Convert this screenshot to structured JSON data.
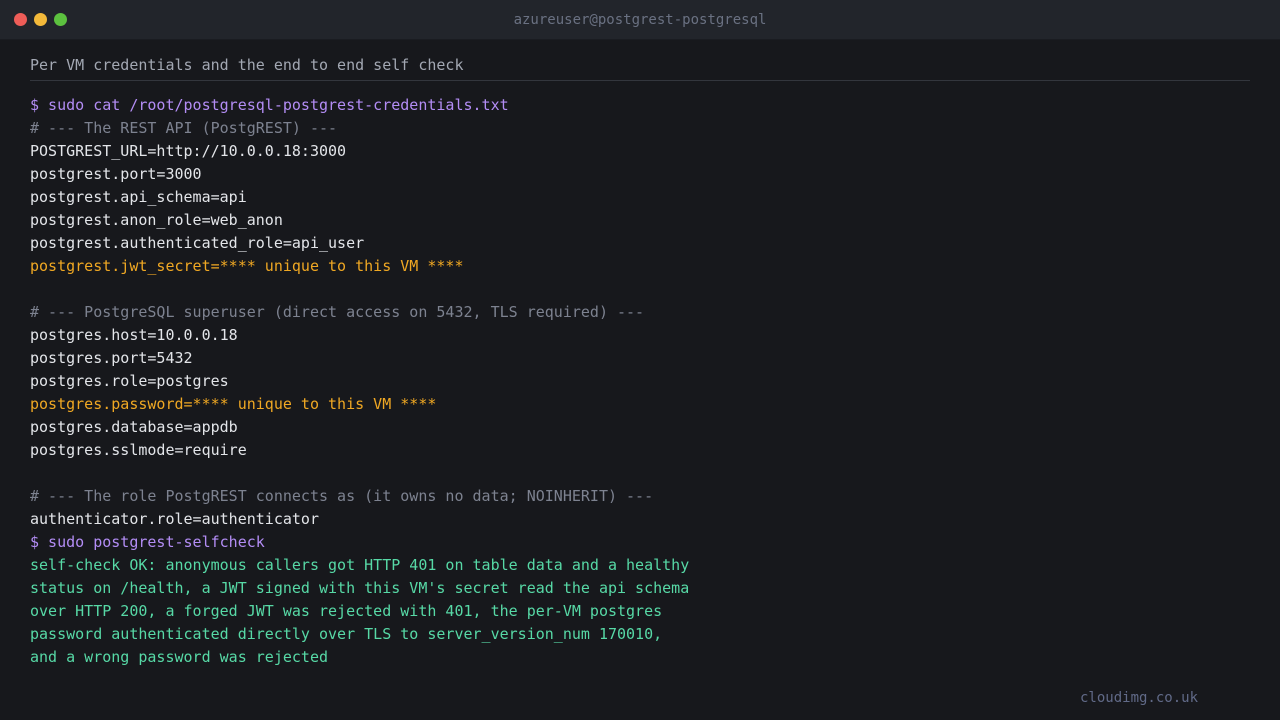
{
  "window": {
    "title": "azureuser@postgrest-postgresql"
  },
  "subtitle": "Per VM credentials and the end to end self check",
  "terminal": {
    "lines": [
      {
        "type": "cmd",
        "text": "$ sudo cat /root/postgresql-postgrest-credentials.txt"
      },
      {
        "type": "comment",
        "text": "# --- The REST API (PostgREST) ---"
      },
      {
        "type": "kv",
        "text": "POSTGREST_URL=http://10.0.0.18:3000"
      },
      {
        "type": "kv",
        "text": "postgrest.port=3000"
      },
      {
        "type": "kv",
        "text": "postgrest.api_schema=api"
      },
      {
        "type": "kv",
        "text": "postgrest.anon_role=web_anon"
      },
      {
        "type": "kv",
        "text": "postgrest.authenticated_role=api_user"
      },
      {
        "type": "secret",
        "text": "postgrest.jwt_secret=**** unique to this VM ****"
      },
      {
        "type": "blank",
        "text": ""
      },
      {
        "type": "comment",
        "text": "# --- PostgreSQL superuser (direct access on 5432, TLS required) ---"
      },
      {
        "type": "kv",
        "text": "postgres.host=10.0.0.18"
      },
      {
        "type": "kv",
        "text": "postgres.port=5432"
      },
      {
        "type": "kv",
        "text": "postgres.role=postgres"
      },
      {
        "type": "secret",
        "text": "postgres.password=**** unique to this VM ****"
      },
      {
        "type": "kv",
        "text": "postgres.database=appdb"
      },
      {
        "type": "kv",
        "text": "postgres.sslmode=require"
      },
      {
        "type": "blank",
        "text": ""
      },
      {
        "type": "comment",
        "text": "# --- The role PostgREST connects as (it owns no data; NOINHERIT) ---"
      },
      {
        "type": "kv",
        "text": "authenticator.role=authenticator"
      },
      {
        "type": "cmd",
        "text": "$ sudo postgrest-selfcheck"
      },
      {
        "type": "ok",
        "text": "self-check OK: anonymous callers got HTTP 401 on table data and a healthy"
      },
      {
        "type": "ok",
        "text": "status on /health, a JWT signed with this VM's secret read the api schema"
      },
      {
        "type": "ok",
        "text": "over HTTP 200, a forged JWT was rejected with 401, the per-VM postgres"
      },
      {
        "type": "ok",
        "text": "password authenticated directly over TLS to server_version_num 170010,"
      },
      {
        "type": "ok",
        "text": "and a wrong password was rejected"
      }
    ]
  },
  "footer": "cloudimg.co.uk"
}
